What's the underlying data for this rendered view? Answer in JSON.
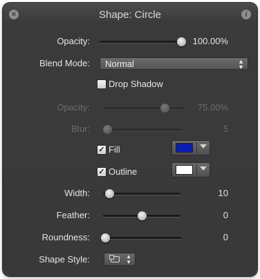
{
  "title": "Shape: Circle",
  "header": {
    "close_icon": "close-icon",
    "info_icon": "info-icon"
  },
  "opacity": {
    "label": "Opacity:",
    "value": "100.00%",
    "level": 1.0
  },
  "blend_mode": {
    "label": "Blend Mode:",
    "selected": "Normal"
  },
  "drop_shadow": {
    "label": "Drop Shadow",
    "checked": false
  },
  "shadow_opacity": {
    "label": "Opacity:",
    "value": "75.00%",
    "level": 0.75
  },
  "shadow_blur": {
    "label": "Blur:",
    "value": "5",
    "level": 0.05
  },
  "fill": {
    "label": "Fill",
    "checked": true,
    "color": "#0a1eb4"
  },
  "outline": {
    "label": "Outline",
    "checked": true,
    "color": "#ffffff"
  },
  "width": {
    "label": "Width:",
    "value": "10",
    "level": 0.08
  },
  "feather": {
    "label": "Feather:",
    "value": "0",
    "level": 0.5
  },
  "roundness": {
    "label": "Roundness:",
    "value": "0",
    "level": 0.0
  },
  "shape_style": {
    "label": "Shape Style:"
  },
  "colors": {
    "panel_bg": "#3a3a3a",
    "text": "#e4e4e4",
    "disabled_text": "#6e6e6e"
  }
}
